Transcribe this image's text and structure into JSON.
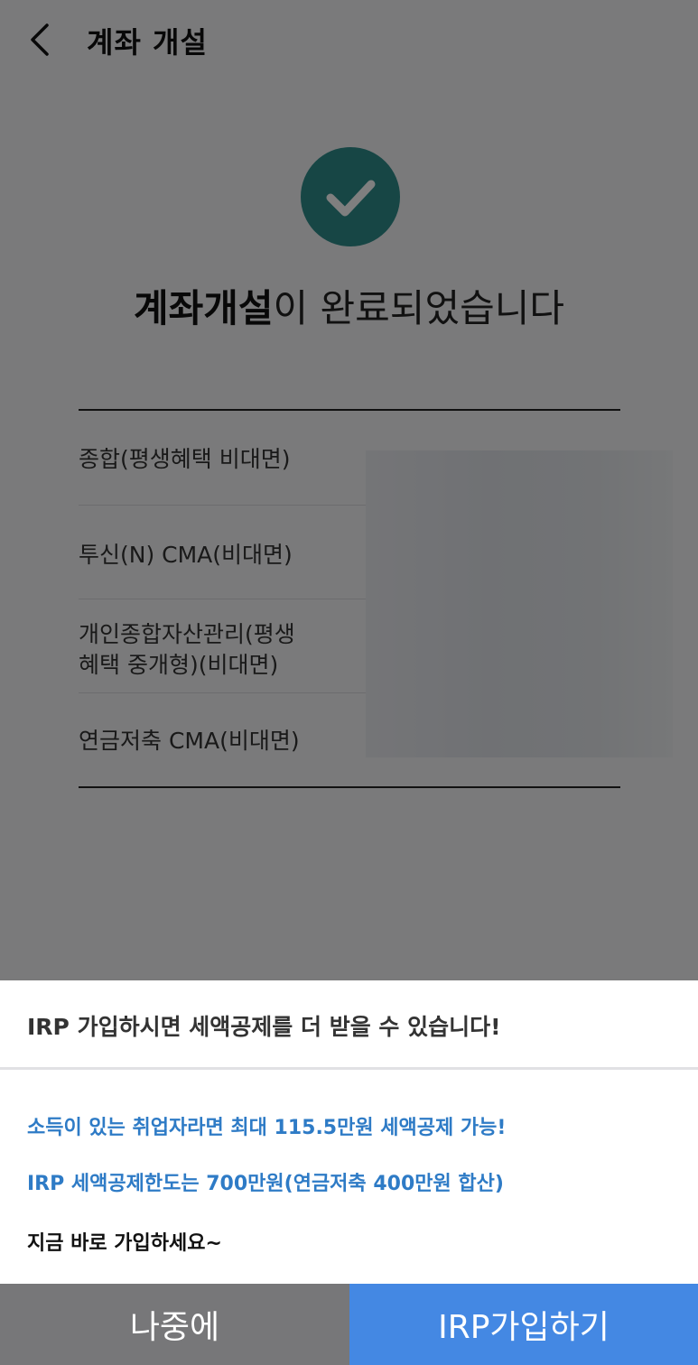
{
  "header": {
    "title": "계좌 개설"
  },
  "completion": {
    "headline_bold": "계좌개설",
    "headline_rest": "이 완료되었습니다"
  },
  "accounts": [
    {
      "name": "종합(평생혜택 비대면)"
    },
    {
      "name": "투신(N) CMA(비대면)"
    },
    {
      "name_line1": "개인종합자산관리(평생",
      "name_line2": "혜택 중개형)(비대면)"
    },
    {
      "name": "연금저축 CMA(비대면)"
    }
  ],
  "popup": {
    "title": "IRP 가입하시면 세액공제를 더 받을 수 있습니다!",
    "line1": "소득이 있는 취업자라면 최대 115.5만원 세액공제 가능!",
    "line2": "IRP 세액공제한도는 700만원(연금저축 400만원 합산)",
    "line3": "지금 바로 가입하세요~",
    "later_button": "나중에",
    "join_button": "IRP가입하기"
  },
  "colors": {
    "check_teal": "#2e8c8b",
    "accent_blue": "#4488e3",
    "info_blue": "#2e7bc6",
    "later_gray": "#777779"
  },
  "icons": [
    "back-arrow-icon",
    "checkmark-icon"
  ]
}
